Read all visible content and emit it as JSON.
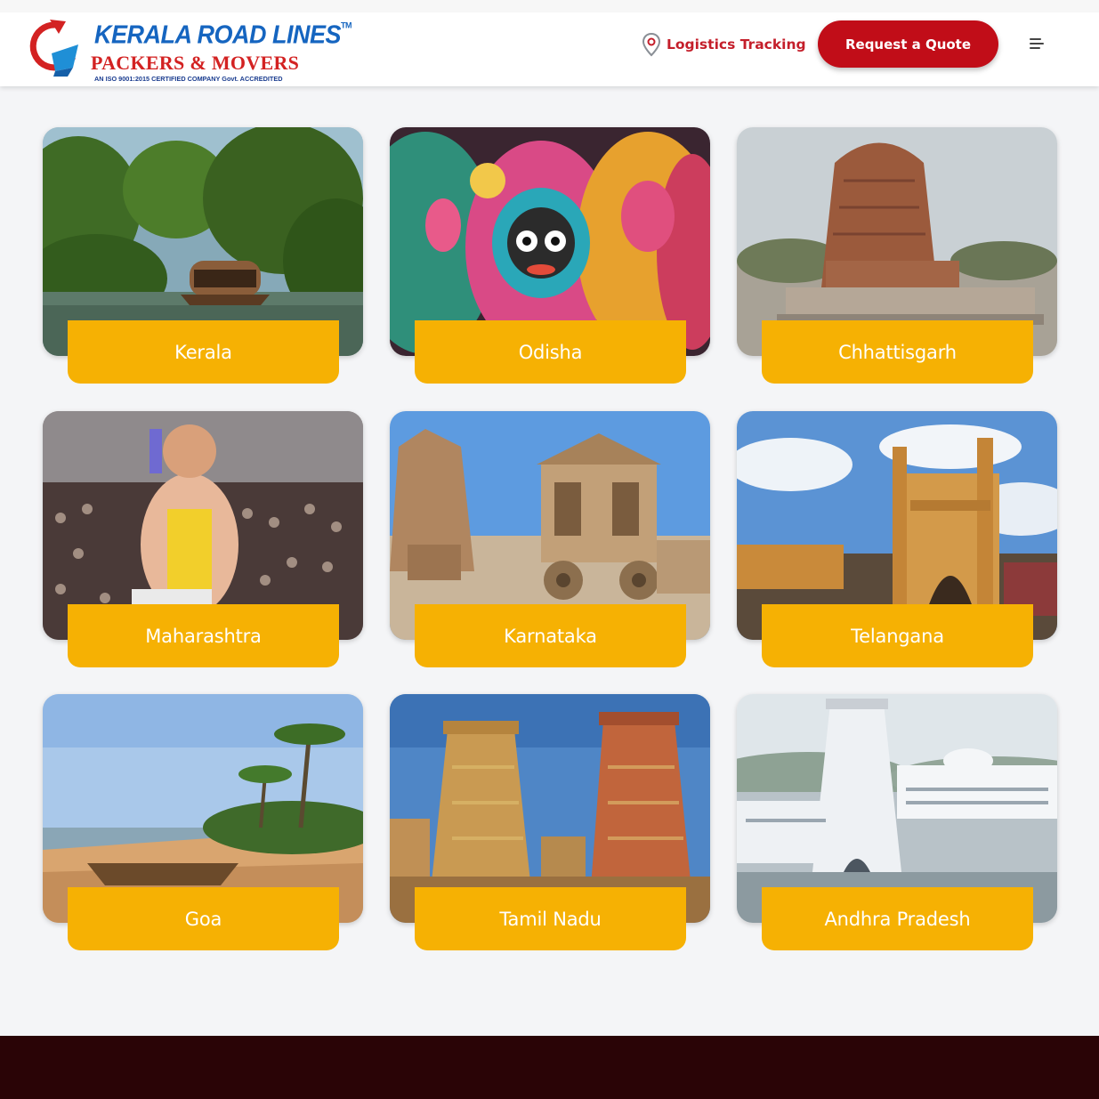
{
  "brand": {
    "title": "KERALA ROAD LINES",
    "tm": "TM",
    "subtitle": "PACKERS & MOVERS",
    "certification": "AN ISO 9001:2015 CERTIFIED COMPANY Govt. ACCREDITED"
  },
  "header": {
    "tracking_label": "Logistics Tracking",
    "quote_label": "Request a Quote"
  },
  "states": [
    {
      "name": "Kerala",
      "icon": "backwaters-houseboat-image"
    },
    {
      "name": "Odisha",
      "icon": "jagannath-art-image"
    },
    {
      "name": "Chhattisgarh",
      "icon": "brick-temple-image"
    },
    {
      "name": "Maharashtra",
      "icon": "ganesh-festival-image"
    },
    {
      "name": "Karnataka",
      "icon": "hampi-stone-chariot-image"
    },
    {
      "name": "Telangana",
      "icon": "charminar-image"
    },
    {
      "name": "Goa",
      "icon": "beach-palms-image"
    },
    {
      "name": "Tamil Nadu",
      "icon": "temple-gopuram-image"
    },
    {
      "name": "Andhra Pradesh",
      "icon": "white-temple-image"
    }
  ],
  "colors": {
    "accent": "#c10d18",
    "label_bg": "#f6b103",
    "footer_bg": "#2a0406",
    "brand_blue": "#1565c0",
    "brand_red": "#d32222"
  }
}
